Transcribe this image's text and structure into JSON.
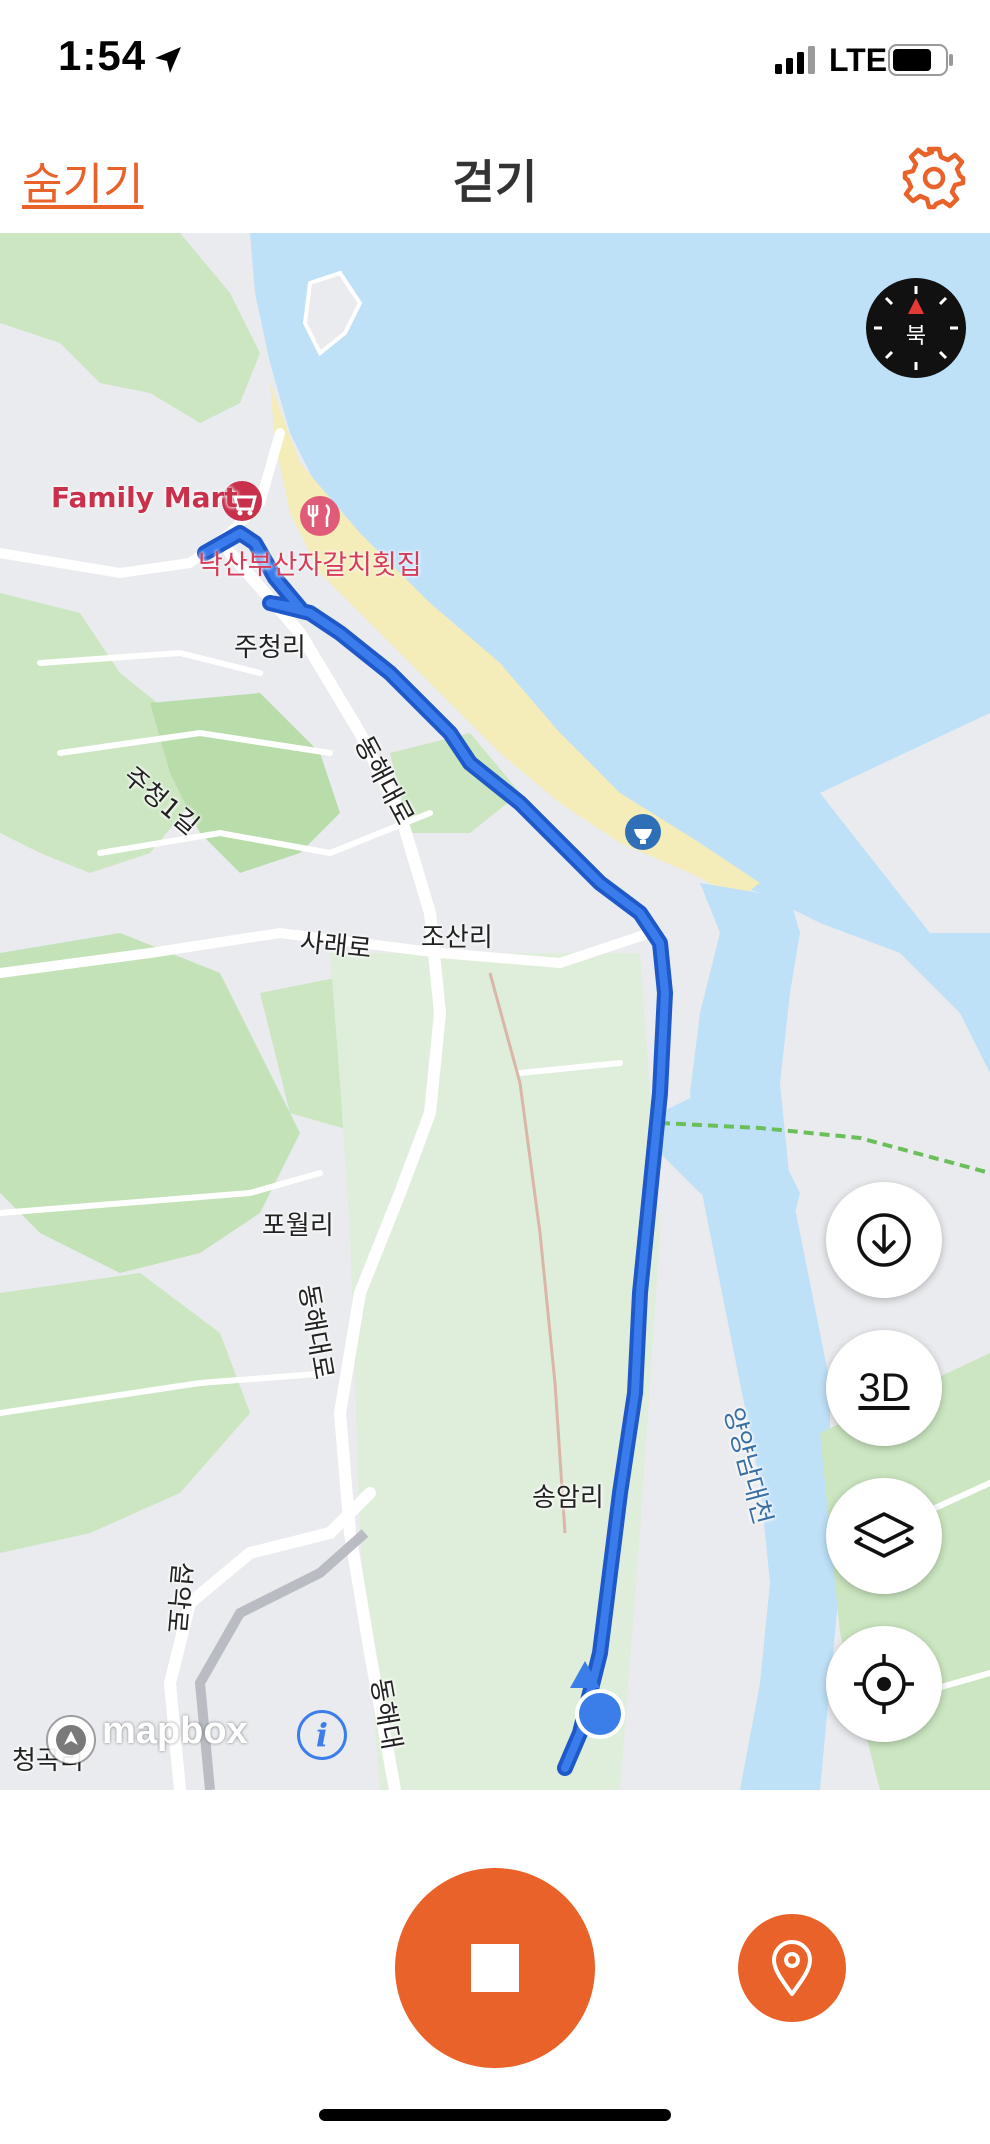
{
  "status_bar": {
    "time": "1:54",
    "network": "LTE"
  },
  "nav": {
    "hide_label": "숨기기",
    "title": "걷기"
  },
  "map": {
    "compass_label": "북",
    "poi": {
      "family_mart": "Family Mart",
      "restaurant": "낙산부산자갈치횟집"
    },
    "places": {
      "jucheong_ri": "주청리",
      "jucheong_1gil": "주청1길",
      "donghae_daero_1": "동해대로",
      "sarae_ro": "사래로",
      "josan_ri": "조산리",
      "powol_ri": "포월리",
      "donghae_daero_2": "동해대로",
      "songam_ri": "송암리",
      "seorak_ro": "설악로",
      "donghae_daero_3": "동해대",
      "yangyang_namdaecheon": "양양남대천",
      "cheonggok_ri": "청곡리"
    },
    "attribution": "mapbox",
    "info_label": "i",
    "buttons": {
      "three_d_label": "3D"
    }
  },
  "colors": {
    "accent": "#e8622a",
    "route": "#2f6fdd",
    "water": "#bfe1f8",
    "park": "#cbe6c1"
  },
  "icons": [
    "location-arrow-icon",
    "gear-icon",
    "compass-icon",
    "download-icon",
    "layers-icon",
    "locate-icon",
    "stop-icon",
    "map-pin-icon"
  ]
}
